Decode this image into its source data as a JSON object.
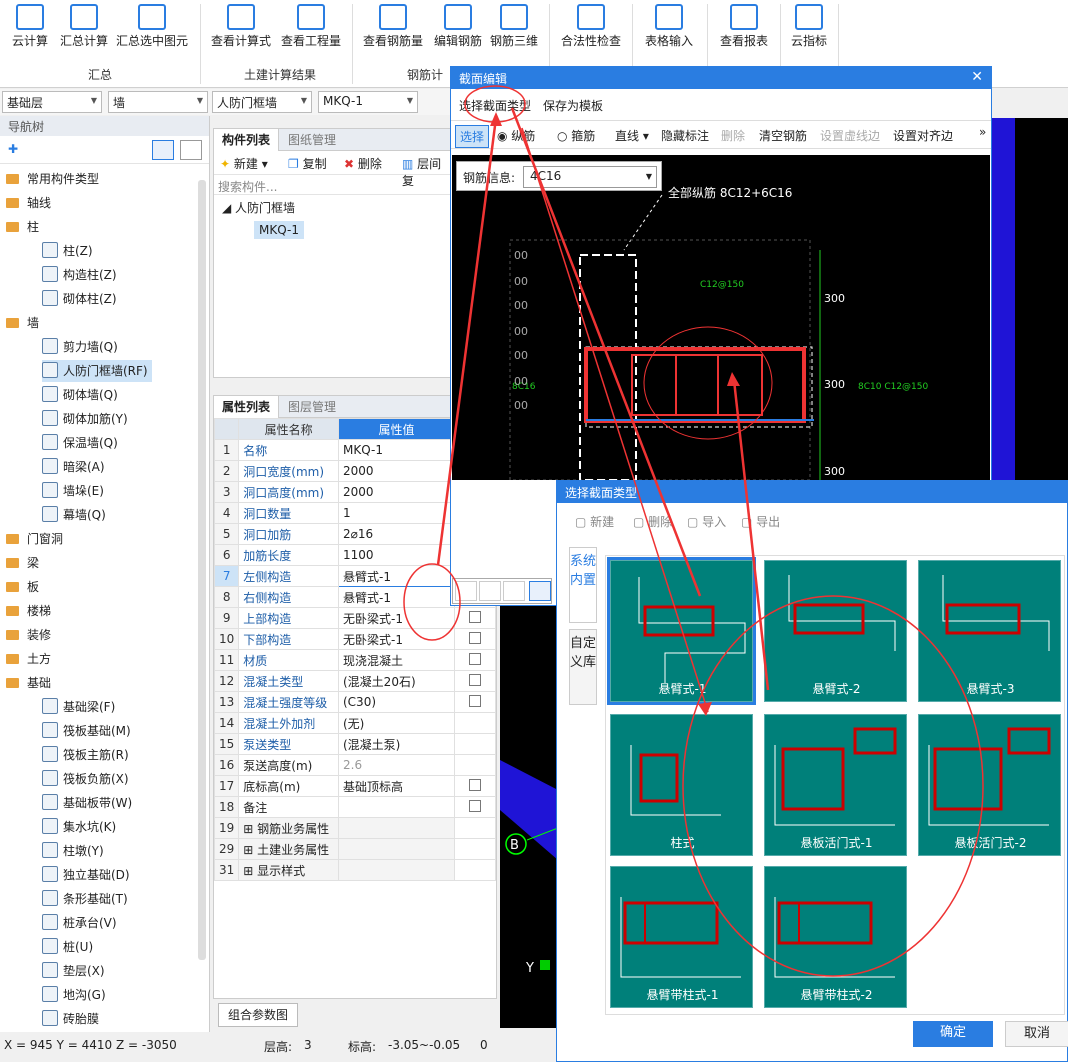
{
  "ribbon": {
    "buttons": [
      {
        "label": "云计算",
        "icon": "cloud-sigma-icon"
      },
      {
        "label": "汇总计算",
        "icon": "sigma-icon"
      },
      {
        "label": "汇总选中图元",
        "icon": "sum-selected-icon"
      },
      {
        "label": "查看计算式",
        "icon": "view-formula-icon"
      },
      {
        "label": "查看工程量",
        "icon": "view-quantity-icon"
      },
      {
        "label": "查看钢筋量",
        "icon": "view-rebar-icon"
      },
      {
        "label": "编辑钢筋",
        "icon": "edit-rebar-icon"
      },
      {
        "label": "钢筋三维",
        "icon": "rebar-3d-icon"
      },
      {
        "label": "合法性检查",
        "icon": "check-icon"
      },
      {
        "label": "表格输入",
        "icon": "table-input-icon"
      },
      {
        "label": "查看报表",
        "icon": "report-icon"
      },
      {
        "label": "云指标",
        "icon": "cloud-index-icon"
      }
    ],
    "groups": [
      "汇总",
      "土建计算结果",
      "钢筋计"
    ]
  },
  "selectors": [
    "基础层",
    "墙",
    "人防门框墙",
    "MKQ-1"
  ],
  "nav": {
    "header": "导航树",
    "items": [
      {
        "label": "常用构件类型",
        "type": "folder"
      },
      {
        "label": "轴线",
        "type": "folder"
      },
      {
        "label": "柱",
        "type": "folder"
      },
      {
        "label": "柱(Z)",
        "type": "leaf"
      },
      {
        "label": "构造柱(Z)",
        "type": "leaf"
      },
      {
        "label": "砌体柱(Z)",
        "type": "leaf"
      },
      {
        "label": "墙",
        "type": "folder"
      },
      {
        "label": "剪力墙(Q)",
        "type": "leaf"
      },
      {
        "label": "人防门框墙(RF)",
        "type": "leaf",
        "selected": true
      },
      {
        "label": "砌体墙(Q)",
        "type": "leaf"
      },
      {
        "label": "砌体加筋(Y)",
        "type": "leaf"
      },
      {
        "label": "保温墙(Q)",
        "type": "leaf"
      },
      {
        "label": "暗梁(A)",
        "type": "leaf"
      },
      {
        "label": "墙垛(E)",
        "type": "leaf"
      },
      {
        "label": "幕墙(Q)",
        "type": "leaf"
      },
      {
        "label": "门窗洞",
        "type": "folder"
      },
      {
        "label": "梁",
        "type": "folder"
      },
      {
        "label": "板",
        "type": "folder"
      },
      {
        "label": "楼梯",
        "type": "folder"
      },
      {
        "label": "装修",
        "type": "folder"
      },
      {
        "label": "土方",
        "type": "folder"
      },
      {
        "label": "基础",
        "type": "folder"
      },
      {
        "label": "基础梁(F)",
        "type": "leaf"
      },
      {
        "label": "筏板基础(M)",
        "type": "leaf"
      },
      {
        "label": "筏板主筋(R)",
        "type": "leaf"
      },
      {
        "label": "筏板负筋(X)",
        "type": "leaf"
      },
      {
        "label": "基础板带(W)",
        "type": "leaf"
      },
      {
        "label": "集水坑(K)",
        "type": "leaf"
      },
      {
        "label": "柱墩(Y)",
        "type": "leaf"
      },
      {
        "label": "独立基础(D)",
        "type": "leaf"
      },
      {
        "label": "条形基础(T)",
        "type": "leaf"
      },
      {
        "label": "桩承台(V)",
        "type": "leaf"
      },
      {
        "label": "桩(U)",
        "type": "leaf"
      },
      {
        "label": "垫层(X)",
        "type": "leaf"
      },
      {
        "label": "地沟(G)",
        "type": "leaf"
      },
      {
        "label": "砖胎膜",
        "type": "leaf"
      }
    ]
  },
  "complist": {
    "tabs": [
      "构件列表",
      "图纸管理"
    ],
    "toolbar": [
      "新建",
      "复制",
      "删除",
      "层间复"
    ],
    "search_placeholder": "搜索构件...",
    "tree_root": "人防门框墙",
    "tree_child": "MKQ-1"
  },
  "props": {
    "tabs": [
      "属性列表",
      "图层管理"
    ],
    "col_name": "属性名称",
    "col_value": "属性值",
    "rows": [
      {
        "n": "1",
        "name": "名称",
        "value": "MKQ-1",
        "cb": false,
        "blue": true
      },
      {
        "n": "2",
        "name": "洞口宽度(mm)",
        "value": "2000",
        "cb": false,
        "blue": true
      },
      {
        "n": "3",
        "name": "洞口高度(mm)",
        "value": "2000",
        "cb": false,
        "blue": true
      },
      {
        "n": "4",
        "name": "洞口数量",
        "value": "1",
        "cb": false,
        "blue": true
      },
      {
        "n": "5",
        "name": "洞口加筋",
        "value": "2⌀16",
        "cb": false,
        "blue": true
      },
      {
        "n": "6",
        "name": "加筋长度",
        "value": "1100",
        "cb": false,
        "blue": true
      },
      {
        "n": "7",
        "name": "左侧构造",
        "value": "悬臂式-1",
        "cb": false,
        "blue": true,
        "active": true
      },
      {
        "n": "8",
        "name": "右侧构造",
        "value": "悬臂式-1",
        "cb": false,
        "blue": true
      },
      {
        "n": "9",
        "name": "上部构造",
        "value": "无卧梁式-1",
        "cb": true,
        "blue": true
      },
      {
        "n": "10",
        "name": "下部构造",
        "value": "无卧梁式-1",
        "cb": true,
        "blue": true
      },
      {
        "n": "11",
        "name": "材质",
        "value": "现浇混凝土",
        "cb": true,
        "blue": true
      },
      {
        "n": "12",
        "name": "混凝土类型",
        "value": "(混凝土20石)",
        "cb": true,
        "blue": true
      },
      {
        "n": "13",
        "name": "混凝土强度等级",
        "value": "(C30)",
        "cb": true,
        "blue": true
      },
      {
        "n": "14",
        "name": "混凝土外加剂",
        "value": "(无)",
        "cb": false,
        "blue": true
      },
      {
        "n": "15",
        "name": "泵送类型",
        "value": "(混凝土泵)",
        "cb": false,
        "blue": true
      },
      {
        "n": "16",
        "name": "泵送高度(m)",
        "value": "2.6",
        "cb": false,
        "blue": false,
        "grey": true
      },
      {
        "n": "17",
        "name": "底标高(m)",
        "value": "基础顶标高",
        "cb": true,
        "blue": false
      },
      {
        "n": "18",
        "name": "备注",
        "value": "",
        "cb": true,
        "blue": false
      },
      {
        "n": "19",
        "name": "钢筋业务属性",
        "value": "",
        "cb": false,
        "blue": false,
        "group": true
      },
      {
        "n": "29",
        "name": "土建业务属性",
        "value": "",
        "cb": false,
        "blue": false,
        "group": true
      },
      {
        "n": "31",
        "name": "显示样式",
        "value": "",
        "cb": false,
        "blue": false,
        "group": true
      }
    ],
    "combo_button": "组合参数图"
  },
  "status": {
    "coords": "X = 945 Y = 4410 Z = -3050",
    "floor_label": "层高:",
    "floor_value": "3",
    "elev_label": "标高:",
    "elev_value": "-3.05~-0.05",
    "extra": "0"
  },
  "edit_dialog": {
    "title": "截面编辑",
    "menu": [
      "选择截面类型",
      "保存为模板"
    ],
    "toolbar": [
      "选择",
      "纵筋",
      "箍筋",
      "直线",
      "隐藏标注",
      "删除",
      "清空钢筋",
      "设置虚线边",
      "设置对齐边"
    ],
    "rebar_label": "钢筋信息:",
    "rebar_value": "4C16",
    "cad": {
      "all_rebar": "全部纵筋 8C12+6C16",
      "top_stirrup": "C12@150",
      "right_stirrup": "8C10  C12@150",
      "left_label": "8C16",
      "dims": [
        "300",
        "300",
        "300"
      ],
      "left_dims": [
        "00",
        "00",
        "00",
        "00",
        "00",
        "00",
        "00"
      ],
      "axis": "B",
      "axis_y": "Y"
    }
  },
  "select_dialog": {
    "title": "选择截面类型",
    "toolbar": [
      "新建",
      "删除",
      "导入",
      "导出"
    ],
    "side_tabs": [
      "系统内置",
      "自定义库"
    ],
    "tiles": [
      "悬臂式-1",
      "悬臂式-2",
      "悬臂式-3",
      "柱式",
      "悬板活门式-1",
      "悬板活门式-2",
      "悬臂带柱式-1",
      "悬臂带柱式-2"
    ],
    "ok": "确定",
    "cancel": "取消"
  }
}
